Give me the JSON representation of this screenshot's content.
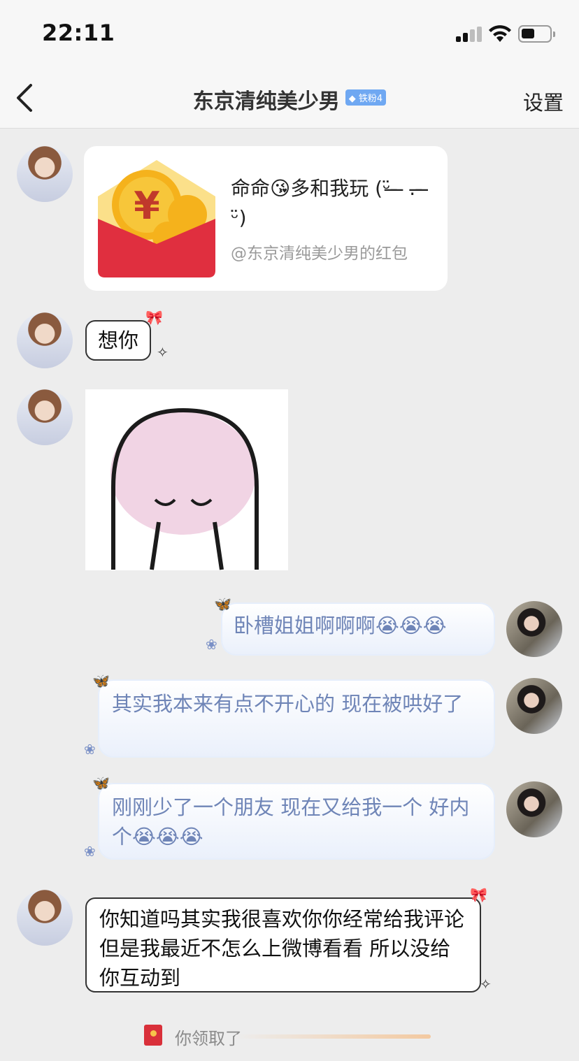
{
  "status": {
    "time": "22:11"
  },
  "nav": {
    "title": "东京清纯美少男",
    "badge": "铁粉4",
    "settings": "设置"
  },
  "messages": {
    "redpacket": {
      "text": "命命😘多和我玩 (ᵕ̈ ̶  ̶ . ̶  ̶ ᵕ̈)",
      "sub": "@东京清纯美少男的红包"
    },
    "m1": "想你",
    "r1": "卧槽姐姐啊啊啊😭😭😭",
    "r2": "其实我本来有点不开心的 现在被哄好了",
    "r3": "刚刚少了一个朋友 现在又给我一个 好内个😭😭😭",
    "m2": "你知道吗其实我很喜欢你你经常给我评论 但是我最近不怎么上微博看看 所以没给你互动到"
  },
  "system": {
    "text": "你领取了"
  },
  "colors": {
    "accent": "#6fa8f2",
    "redpacket": "#e02f3f",
    "right_text": "#6f85b7"
  }
}
